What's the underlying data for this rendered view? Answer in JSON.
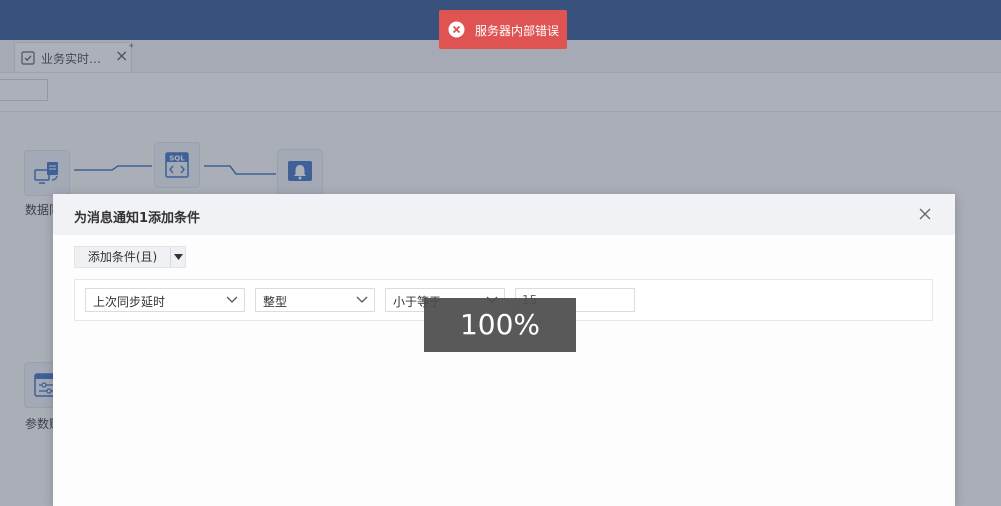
{
  "tabs": [
    {
      "label": "业务实时…",
      "dirty_mark": "*"
    }
  ],
  "flow_nodes": [
    {
      "id": "data-source",
      "label": "数据同",
      "icon": "monitor-sync-icon"
    },
    {
      "id": "sql",
      "label": "",
      "icon": "sql-file-icon",
      "badge": "SQL"
    },
    {
      "id": "notify",
      "label": "",
      "icon": "bell-icon"
    },
    {
      "id": "params",
      "label": "参数赋",
      "icon": "param-card-icon"
    }
  ],
  "dialog": {
    "title": "为消息通知1添加条件",
    "add_condition_label": "添加条件(且)",
    "condition": {
      "field": "上次同步延时",
      "type": "整型",
      "operator": "小于等于",
      "value": "15"
    }
  },
  "toast": {
    "message": "服务器内部错误",
    "icon": "error-circle-icon"
  },
  "zoom": {
    "label": "100%"
  },
  "colors": {
    "topbar": "#2c5592",
    "toast_bg": "#e05353",
    "edge": "#3a6fc4",
    "node_icon": "#3a6fc4"
  }
}
